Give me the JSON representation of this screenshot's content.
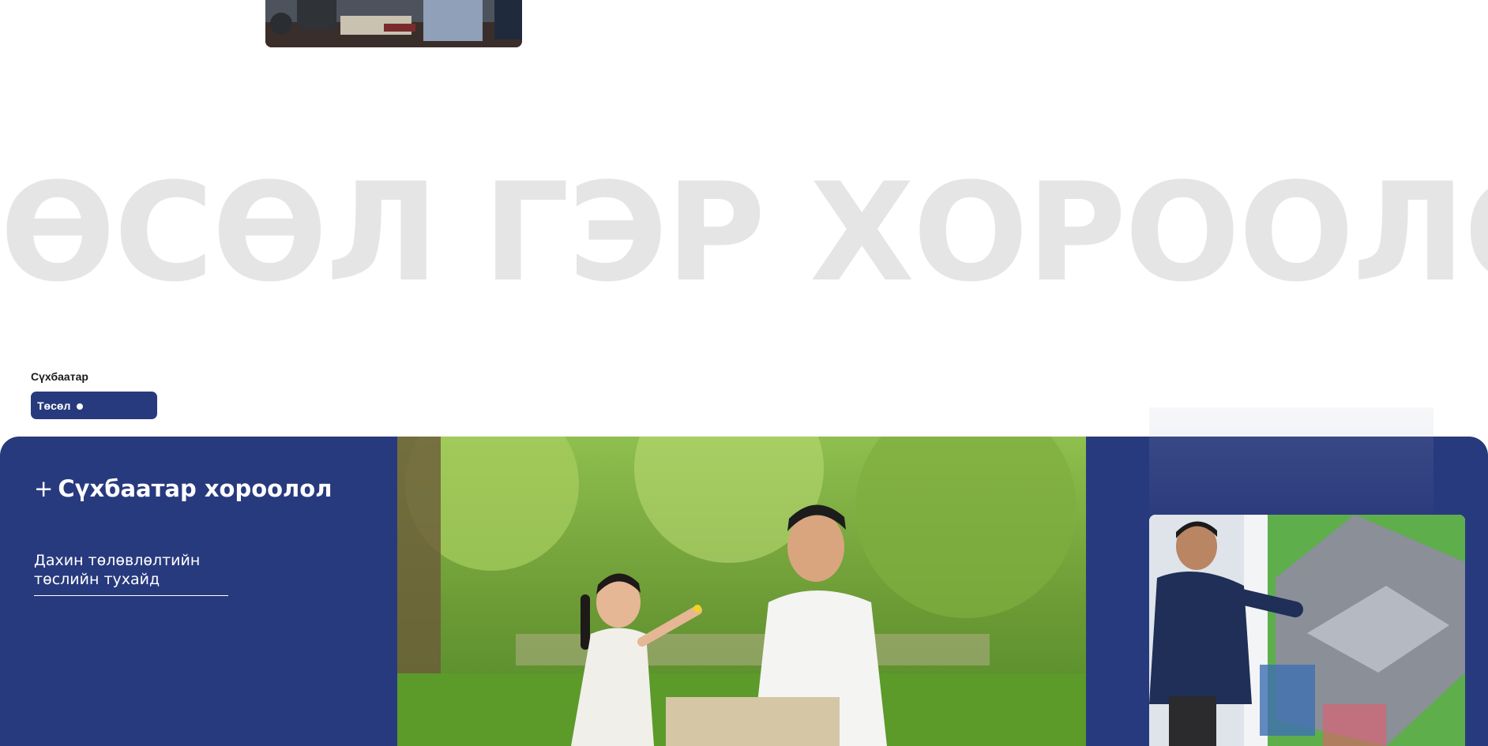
{
  "watermark": {
    "text": "ӨСӨЛ ГЭР ХОРООЛОЛ"
  },
  "district": {
    "label": "Сүхбаатар"
  },
  "project_pill": {
    "label": "Төсөл"
  },
  "band": {
    "title_plus": "+",
    "title": "Сүхбаатар хороолол",
    "link_line1": "Дахин төлөвлөлтийн",
    "link_line2": "төслийн тухайд"
  },
  "colors": {
    "brand_blue": "#283a7e",
    "watermark_gray": "#e5e5e5",
    "text_white": "#ffffff"
  },
  "images": {
    "top_photo": "meeting-photo",
    "main_photo": "father-daughter-park-photo",
    "side_photo": "man-presenting-city-plan-photo",
    "ghost_photo": "faded-office-photo"
  }
}
